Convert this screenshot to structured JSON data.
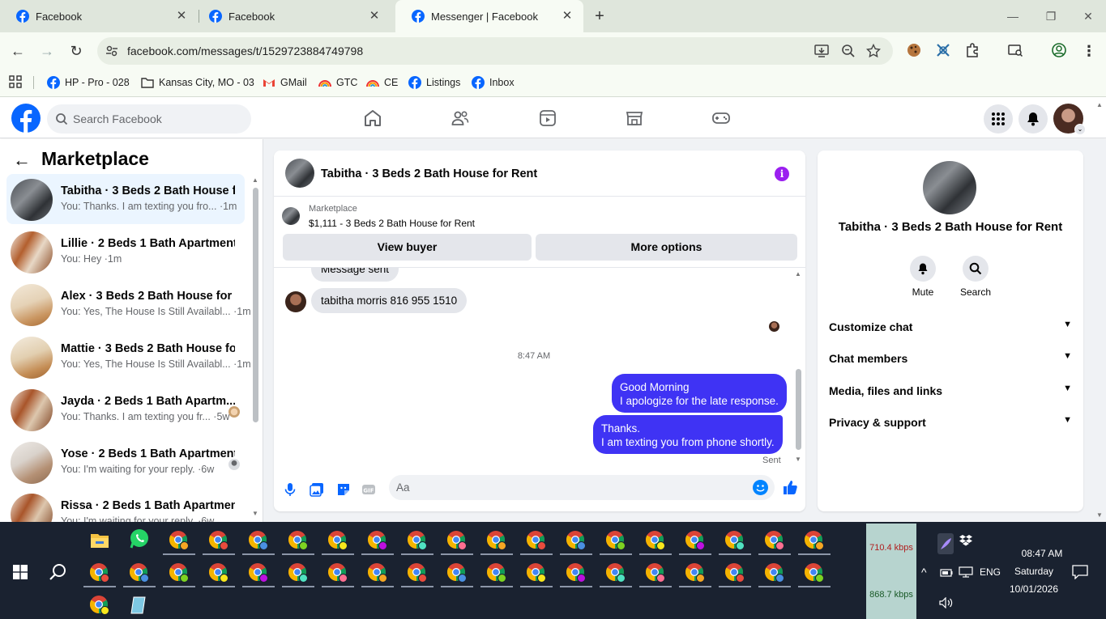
{
  "browser": {
    "tabs": [
      {
        "title": "Facebook",
        "active": false
      },
      {
        "title": "Facebook",
        "active": false
      },
      {
        "title": "Messenger | Facebook",
        "active": true
      }
    ],
    "url": "facebook.com/messages/t/1529723884749798",
    "bookmarks": [
      {
        "label": "HP - Pro - 028",
        "icon": "facebook-icon"
      },
      {
        "label": "Kansas City, MO - 03",
        "icon": "folder-icon"
      },
      {
        "label": "GMail",
        "icon": "gmail-icon"
      },
      {
        "label": "GTC",
        "icon": "rainbow-icon"
      },
      {
        "label": "CE",
        "icon": "rainbow-icon"
      },
      {
        "label": "Listings",
        "icon": "facebook-icon"
      },
      {
        "label": "Inbox",
        "icon": "facebook-icon"
      }
    ]
  },
  "facebook": {
    "search_placeholder": "Search Facebook",
    "brand_color": "#0866ff"
  },
  "sidebar": {
    "title": "Marketplace",
    "conversations": [
      {
        "name": "Tabitha · 3 Beds 2 Bath House f...",
        "preview": "You: Thanks. I am texting you fro... ·1m",
        "selected": true
      },
      {
        "name": "Lillie · 2 Beds 1 Bath Apartment ...",
        "preview": "You: Hey ·1m",
        "selected": false
      },
      {
        "name": "Alex · 3 Beds 2 Bath House for R...",
        "preview": "You: Yes, The House Is Still Availabl... ·1m",
        "selected": false
      },
      {
        "name": "Mattie · 3 Beds 2 Bath House fo...",
        "preview": "You: Yes, The House Is Still Availabl... ·1m",
        "selected": false
      },
      {
        "name": "Jayda · 2 Beds 1 Bath Apartm...",
        "preview": "You: Thanks. I am texting you fr... ·5w",
        "selected": false
      },
      {
        "name": "Yose · 2 Beds 1 Bath Apartment",
        "preview": "You: I'm waiting for your reply. ·6w",
        "selected": false
      },
      {
        "name": "Rissa · 2 Beds 1 Bath Apartment ...",
        "preview": "You: I'm waiting for your reply. ·6w",
        "selected": false
      }
    ]
  },
  "chat": {
    "title": "Tabitha · 3 Beds 2 Bath House for Rent",
    "marketplace_label": "Marketplace",
    "listing": "$1,111 - 3 Beds 2 Bath House for Rent",
    "view_buyer": "View buyer",
    "more_options": "More options",
    "partial_message": "Message sent",
    "incoming_message": "tabitha morris  816 955 1510",
    "timestamp": "8:47 AM",
    "outgoing_1_line1": "Good Morning",
    "outgoing_1_line2": "I apologize for the late response.",
    "outgoing_2_line1": "Thanks.",
    "outgoing_2_line2": "I am texting you from phone shortly.",
    "status": "Sent",
    "composer_placeholder": "Aa",
    "accent_color": "#3f33f4"
  },
  "info_panel": {
    "name": "Tabitha · 3 Beds 2 Bath House for Rent",
    "mute": "Mute",
    "search": "Search",
    "sections": [
      "Customize chat",
      "Chat members",
      "Media, files and links",
      "Privacy & support"
    ]
  },
  "taskbar": {
    "net_up": "710.4 kbps",
    "net_down": "868.7 kbps",
    "lang": "ENG",
    "time": "08:47 AM",
    "day": "Saturday",
    "date": "10/01/2026"
  }
}
